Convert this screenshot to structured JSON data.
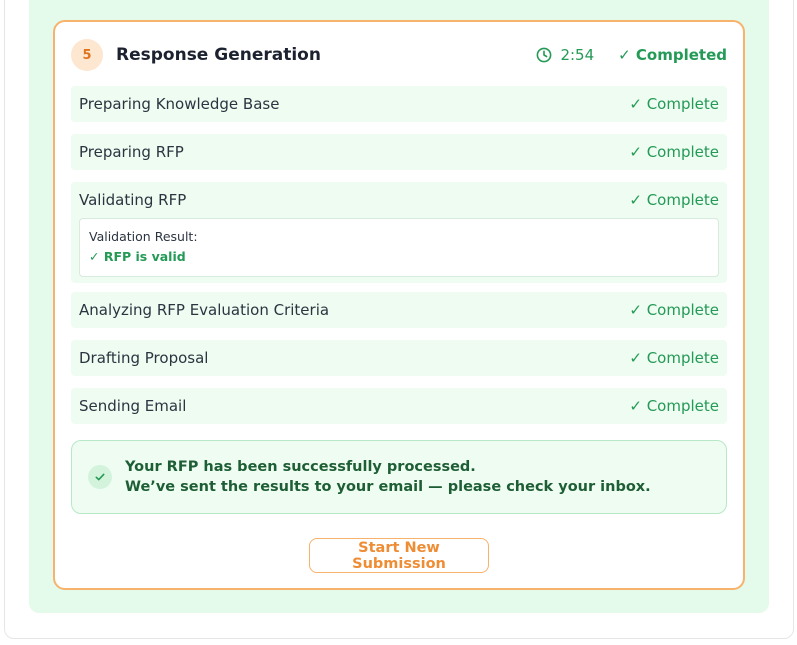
{
  "step": {
    "number": "5",
    "title": "Response Generation",
    "timer": "2:54",
    "status": "✓ Completed"
  },
  "substeps": [
    {
      "label": "Preparing Knowledge Base",
      "status": "✓ Complete"
    },
    {
      "label": "Preparing RFP",
      "status": "✓ Complete"
    },
    {
      "label": "Validating RFP",
      "status": "✓ Complete"
    },
    {
      "label": "Analyzing RFP Evaluation Criteria",
      "status": "✓ Complete"
    },
    {
      "label": "Drafting Proposal",
      "status": "✓ Complete"
    },
    {
      "label": "Sending Email",
      "status": "✓ Complete"
    }
  ],
  "validation": {
    "title": "Validation Result:",
    "value": "✓ RFP is valid"
  },
  "success": {
    "line1": "Your RFP has been successfully processed.",
    "line2": "We’ve sent the results to your email — please check your inbox."
  },
  "actions": {
    "new_submission_label": "Start New Submission"
  },
  "colors": {
    "accent_orange": "#f7b26b",
    "success_green": "#239a55",
    "panel_green": "#e4faea"
  },
  "icons": {
    "timer": "clock-icon",
    "success": "check-icon"
  }
}
